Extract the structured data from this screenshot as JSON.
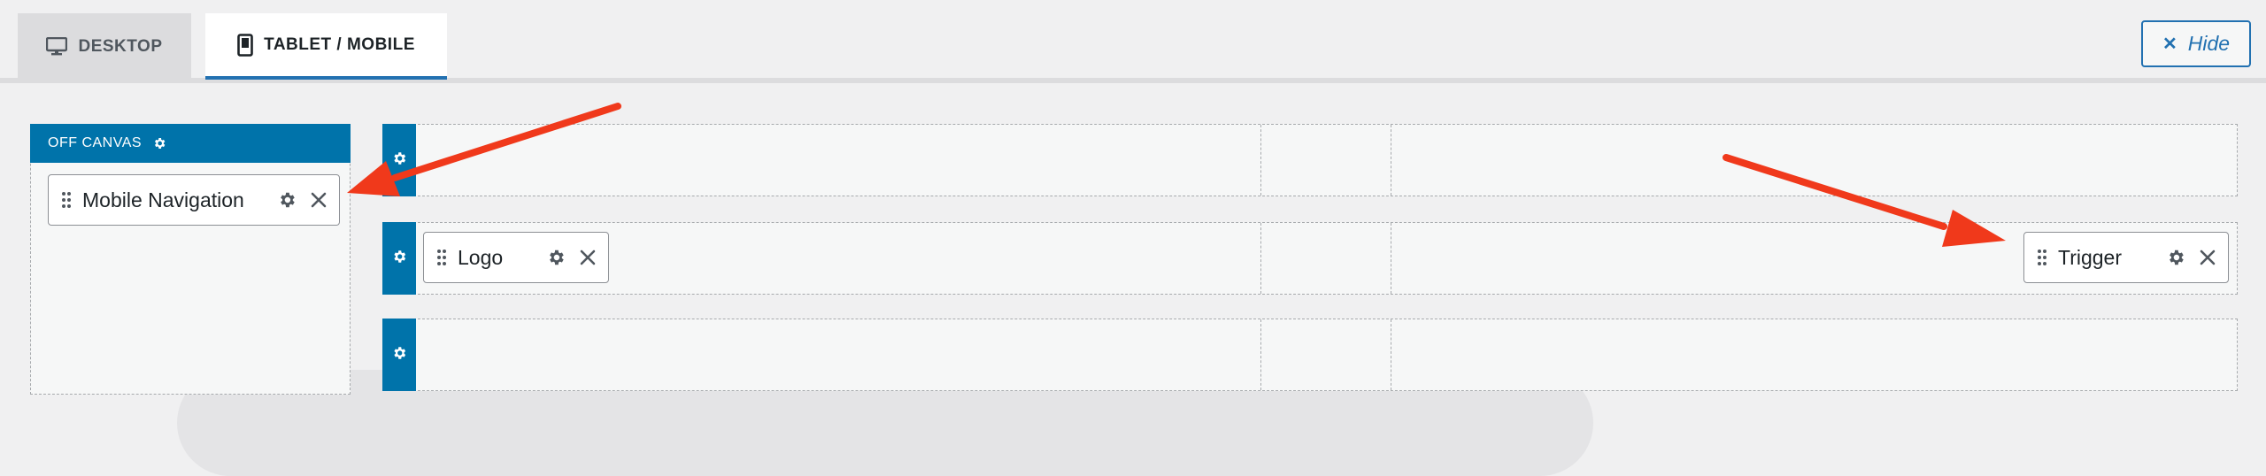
{
  "tabs": {
    "desktop": {
      "label": "DESKTOP",
      "icon": "desktop-icon"
    },
    "mobile": {
      "label": "TABLET / MOBILE",
      "icon": "mobile-icon"
    }
  },
  "hide_button": {
    "label": "Hide",
    "icon": "close-icon"
  },
  "off_canvas": {
    "title": "OFF CANVAS",
    "items": [
      {
        "label": "Mobile Navigation"
      }
    ]
  },
  "rows": {
    "top": {
      "items": []
    },
    "main": {
      "items": [
        {
          "label": "Logo"
        },
        {
          "label": "Trigger"
        }
      ]
    },
    "bottom": {
      "items": []
    }
  },
  "colors": {
    "accent": "#0073aa",
    "tab_underline": "#2271b1",
    "arrow": "#f0391b"
  }
}
